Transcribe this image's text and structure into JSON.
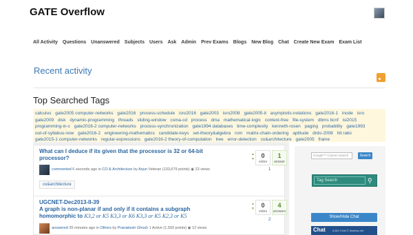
{
  "site": {
    "title": "GATE Overflow"
  },
  "nav": [
    "All Activity",
    "Questions",
    "Unanswered",
    "Subjects",
    "Users",
    "Ask",
    "Admin",
    "Prev Exams",
    "Blogs",
    "New Blog",
    "Chat",
    "Create New Exam",
    "Exam List"
  ],
  "recent": {
    "title": "Recent activity"
  },
  "tags": {
    "title": "Top Searched Tags",
    "items": [
      "calculus",
      "gate2005 computer-networks",
      "gate2016",
      "process-schedule",
      "isro2016",
      "gate2003",
      "isro2008",
      "gate2005-it",
      "asymptotic-notations",
      "gate2016-1",
      "inode",
      "isro",
      "gate2009",
      "disk",
      "dynamic-programming",
      "threads",
      "sliding-window",
      "csma-cd",
      "process",
      "dma",
      "mathematical-logic",
      "context-free",
      "file-system",
      "dbms bcnf",
      "isi2015",
      "programming-in-c",
      "gate2016-2 computer-networks",
      "process-synchronization",
      "gate1994 databases",
      "time-complexity",
      "kenneth-rosen",
      "paging",
      "probability",
      "gate1993",
      "out-of-syllabus-now",
      "gate2016-2",
      "engineering-mathematics",
      "candidate-keys",
      "set-theory&algebra",
      "rom",
      "matrix-chain-ordering",
      "aptitude",
      "drdo-2008",
      "hit ratio",
      "gate2015-1 computer-networks",
      "regular-expressions",
      "gate2016-2 theory-of-computation",
      "tree",
      "error-detection",
      "co&architecture",
      "gate2005",
      "frame"
    ]
  },
  "questions": [
    {
      "title": "What can I deduce if its given that the processor is 32 or 64-bit processor?",
      "action": "commented",
      "time": "6 seconds ago",
      "in_word": "in",
      "category": "CO & Architecture",
      "by_word": "by",
      "user": "Arjun",
      "user_info": "Veteran (133,679 points)",
      "views": "23 views",
      "votes": "0",
      "votes_label": "votes",
      "answers": "1",
      "answers_label": "answer",
      "extra_count": "1",
      "tag": "co&architecture"
    },
    {
      "title_line1": "UGCNET-Dec2013-II-39",
      "title_line2": "A graph is non-planar if and only if it contains a subgraph",
      "title_line3_prefix": "homomorphic to",
      "title_line3_math": "K3,2 or K5  K3,3 or K6  K3,3 or K5  K2,3 or K5",
      "action": "answered",
      "time": "35 minutes ago",
      "in_word": "in",
      "category": "Others",
      "by_word": "by",
      "user": "Pranabesh Ghosh",
      "user_info": "1 Active (1,593 points)",
      "views": "12 views",
      "votes": "0",
      "votes_label": "votes",
      "answers": "4",
      "answers_label": "answers",
      "extra_count": "2"
    }
  ],
  "sidebar": {
    "search_placeholder": "Google™ Custom Search",
    "search_button": "Search",
    "tag_search_placeholder": "Tag Search",
    "show_hide": "Show/Hide Chat",
    "chat_label": "Chat",
    "chat_sub": "AJAX Chat © blueimp.net"
  },
  "colors": {
    "link": "#2a65a0",
    "accent": "#3a86c8",
    "tag_bg": "#fff7dd",
    "tag_search_bg": "#2e8b7d"
  }
}
